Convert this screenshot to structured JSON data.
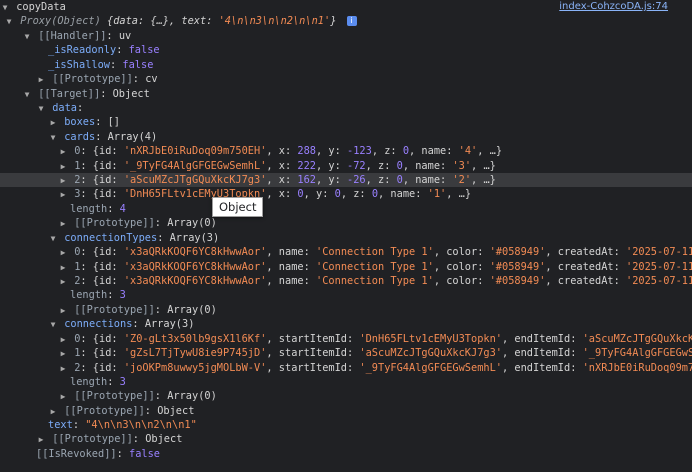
{
  "header": {
    "label": "copyData",
    "source_link": "index-CohzcoDA.js:74"
  },
  "proxy": {
    "summary_prefix": "Proxy(Object) ",
    "summary_body": "{data: {…}, text: ",
    "summary_text": "'4\\n\\n3\\n\\n2\\n\\n1'",
    "summary_end": "}"
  },
  "handler": {
    "label": "[[Handler]]",
    "value": "uv",
    "is_readonly_key": "_isReadonly",
    "is_readonly_val": "false",
    "is_shallow_key": "_isShallow",
    "is_shallow_val": "false",
    "prototype_key": "[[Prototype]]",
    "prototype_val": "cv"
  },
  "target": {
    "label": "[[Target]]",
    "value": "Object",
    "data_key": "data",
    "boxes_key": "boxes",
    "boxes_val": "[]",
    "cards_key": "cards",
    "cards_val": "Array(4)",
    "cards": [
      {
        "idx": "0",
        "id": "'nXRJbE0iRuDoq09m750EH'",
        "x": "288",
        "y": "-123",
        "z": "0",
        "name": "'4'"
      },
      {
        "idx": "1",
        "id": "'_9TyFG4AlgGFGEGwSemhL'",
        "x": "222",
        "y": "-72",
        "z": "0",
        "name": "'3'"
      },
      {
        "idx": "2",
        "id": "'aScuMZcJTgGQuXkcKJ7g3'",
        "x": "162",
        "y": "-26",
        "z": "0",
        "name": "'2'"
      },
      {
        "idx": "3",
        "id": "'DnH65FLtv1cEMyU3Topkn'",
        "x": "0",
        "y": "0",
        "z": "0",
        "name": "'1'"
      }
    ],
    "cards_length_key": "length",
    "cards_length": "4",
    "proto_key": "[[Prototype]]",
    "array_proto": "Array(0)",
    "conn_types_key": "connectionTypes",
    "conn_types_val": "Array(3)",
    "conn_types": [
      {
        "idx": "0",
        "id": "'x3aQRkKOQF6YC8kHwwAor'",
        "name": "'Connection Type 1'",
        "color": "'#058949'",
        "createdAt": "'2025-07-11T12"
      },
      {
        "idx": "1",
        "id": "'x3aQRkKOQF6YC8kHwwAor'",
        "name": "'Connection Type 1'",
        "color": "'#058949'",
        "createdAt": "'2025-07-11T12"
      },
      {
        "idx": "2",
        "id": "'x3aQRkKOQF6YC8kHwwAor'",
        "name": "'Connection Type 1'",
        "color": "'#058949'",
        "createdAt": "'2025-07-11T12"
      }
    ],
    "conn_types_length": "3",
    "connections_key": "connections",
    "connections_val": "Array(3)",
    "connections": [
      {
        "idx": "0",
        "id": "'Z0-gLt3x50lb9gsX1l6Kf'",
        "start": "'DnH65FLtv1cEMyU3Topkn'",
        "end": "'aScuMZcJTgGQuXkcKJ7g"
      },
      {
        "idx": "1",
        "id": "'gZsL7TjTywU8ie9P745jD'",
        "start": "'aScuMZcJTgGQuXkcKJ7g3'",
        "end": "'_9TyFG4AlgGFGEGwSemh"
      },
      {
        "idx": "2",
        "id": "'joOKPm8uwwy5jgMOLbW-V'",
        "start": "'_9TyFG4AlgGFGEGwSemhL'",
        "end": "'nXRJbE0iRuDoq09m750E"
      }
    ],
    "connections_length": "3",
    "object_proto": "Object",
    "text_key": "text",
    "text_val": "\"4\\n\\n3\\n\\n2\\n\\n1\""
  },
  "is_revoked": {
    "key": "[[IsRevoked]]",
    "val": "false"
  },
  "tooltip": {
    "text": "Object"
  }
}
